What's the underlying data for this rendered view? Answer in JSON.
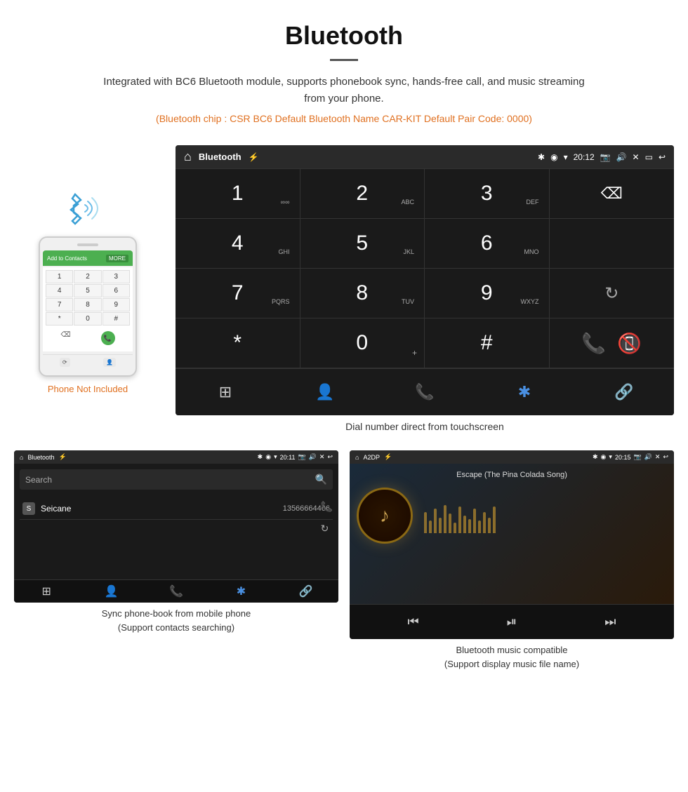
{
  "header": {
    "title": "Bluetooth",
    "description": "Integrated with BC6 Bluetooth module, supports phonebook sync, hands-free call, and music streaming from your phone.",
    "specs": "(Bluetooth chip : CSR BC6    Default Bluetooth Name CAR-KIT    Default Pair Code: 0000)"
  },
  "phone_mockup": {
    "label": "Phone Not Included",
    "top_bar_text": "Add to Contacts",
    "more_btn": "MORE",
    "keys": [
      "1",
      "2",
      "3",
      "4",
      "5",
      "6",
      "7",
      "8",
      "9",
      "*",
      "0",
      "#"
    ]
  },
  "large_screen": {
    "status_bar": {
      "app_name": "Bluetooth",
      "time": "20:12"
    },
    "dial": {
      "rows": [
        {
          "num": "1",
          "sub": "∞∞",
          "col": 1
        },
        {
          "num": "2",
          "sub": "ABC",
          "col": 2
        },
        {
          "num": "3",
          "sub": "DEF",
          "col": 3
        },
        {
          "num": "4",
          "sub": "GHI",
          "col": 1
        },
        {
          "num": "5",
          "sub": "JKL",
          "col": 2
        },
        {
          "num": "6",
          "sub": "MNO",
          "col": 3
        },
        {
          "num": "7",
          "sub": "PQRS",
          "col": 1
        },
        {
          "num": "8",
          "sub": "TUV",
          "col": 2
        },
        {
          "num": "9",
          "sub": "WXYZ",
          "col": 3
        },
        {
          "num": "*",
          "sub": "",
          "col": 1
        },
        {
          "num": "0",
          "sub": "+",
          "col": 2
        },
        {
          "num": "#",
          "sub": "",
          "col": 3
        }
      ]
    },
    "caption": "Dial number direct from touchscreen"
  },
  "phonebook_screen": {
    "status": {
      "app_name": "Bluetooth",
      "time": "20:11"
    },
    "search_placeholder": "Search",
    "contacts": [
      {
        "letter": "S",
        "name": "Seicane",
        "number": "13566664466"
      }
    ],
    "caption": "Sync phone-book from mobile phone\n(Support contacts searching)"
  },
  "music_screen": {
    "status": {
      "app_name": "A2DP",
      "time": "20:15"
    },
    "song_title": "Escape (The Pina Colada Song)",
    "eq_bars": [
      30,
      18,
      35,
      22,
      40,
      28,
      15,
      38,
      25,
      20,
      35,
      18,
      30,
      22,
      38
    ],
    "caption": "Bluetooth music compatible\n(Support display music file name)"
  },
  "icons": {
    "home": "⌂",
    "usb": "⚡",
    "bluetooth": "₿",
    "location": "◉",
    "wifi": "▾",
    "time_label": "20:12",
    "camera": "📷",
    "volume": "🔊",
    "close_x": "✕",
    "window": "▭",
    "back": "↩",
    "keypad": "⊞",
    "person": "👤",
    "phone": "📞",
    "bt": "🔵",
    "link": "🔗",
    "backspace": "⌫",
    "refresh": "↻",
    "call_green": "📞",
    "call_red": "📵",
    "search": "🔍",
    "music_note": "♪",
    "skip_prev": "⏮",
    "play_pause": "⏯",
    "skip_next": "⏭"
  }
}
